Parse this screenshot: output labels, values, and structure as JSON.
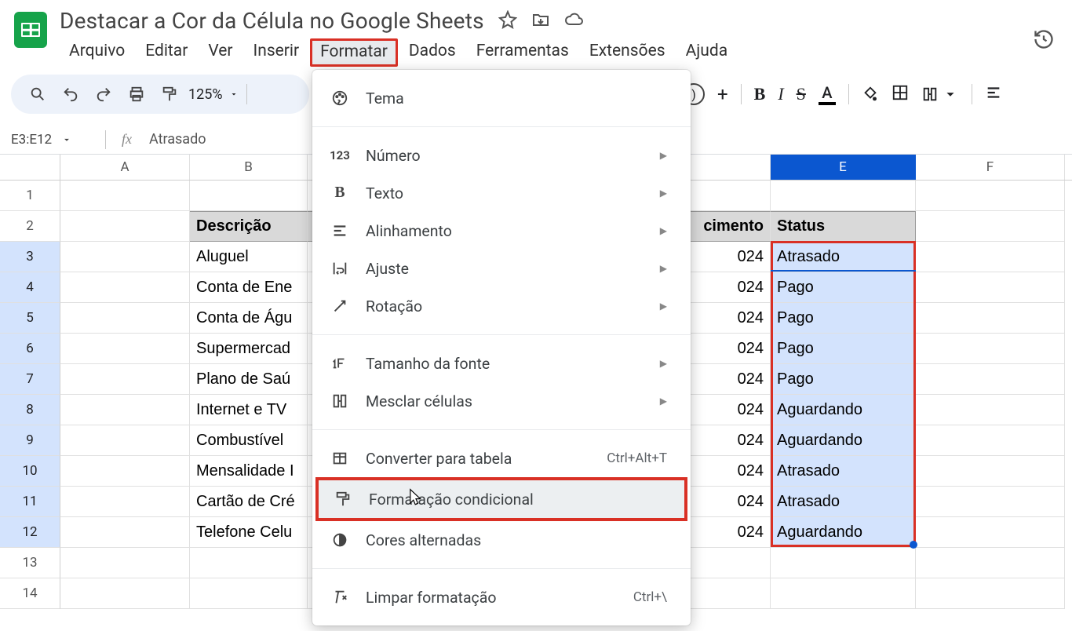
{
  "doc": {
    "title": "Destacar a Cor da Célula no Google Sheets"
  },
  "menubar": [
    "Arquivo",
    "Editar",
    "Ver",
    "Inserir",
    "Formatar",
    "Dados",
    "Ferramentas",
    "Extensões",
    "Ajuda"
  ],
  "activeMenuIndex": 4,
  "toolbar": {
    "zoom": "125%"
  },
  "namebox": "E3:E12",
  "formula": "Atrasado",
  "columns": {
    "A": "A",
    "B": "B",
    "D": "cimento",
    "E": "E",
    "F": "F"
  },
  "headers": {
    "B": "Descrição",
    "D": "cimento",
    "E": "Status"
  },
  "rows": [
    {
      "n": 1
    },
    {
      "n": 2,
      "B": "Descrição",
      "D": "cimento",
      "E": "Status",
      "isHeader": true
    },
    {
      "n": 3,
      "B": "Aluguel",
      "D": "024",
      "E": "Atrasado"
    },
    {
      "n": 4,
      "B": "Conta de Ene",
      "D": "024",
      "E": "Pago"
    },
    {
      "n": 5,
      "B": "Conta de Águ",
      "D": "024",
      "E": "Pago"
    },
    {
      "n": 6,
      "B": "Supermercad",
      "D": "024",
      "E": "Pago"
    },
    {
      "n": 7,
      "B": "Plano de Saú",
      "D": "024",
      "E": "Pago"
    },
    {
      "n": 8,
      "B": "Internet e TV",
      "D": "024",
      "E": "Aguardando"
    },
    {
      "n": 9,
      "B": "Combustível",
      "D": "024",
      "E": "Aguardando"
    },
    {
      "n": 10,
      "B": "Mensalidade I",
      "D": "024",
      "E": "Atrasado"
    },
    {
      "n": 11,
      "B": "Cartão de Cré",
      "D": "024",
      "E": "Atrasado"
    },
    {
      "n": 12,
      "B": "Telefone Celu",
      "D": "024",
      "E": "Aguardando"
    },
    {
      "n": 13
    },
    {
      "n": 14
    }
  ],
  "formatMenu": {
    "theme": "Tema",
    "number": "Número",
    "text": "Texto",
    "align": "Alinhamento",
    "wrap": "Ajuste",
    "rotate": "Rotação",
    "fontsize": "Tamanho da fonte",
    "merge": "Mesclar células",
    "toTable": "Converter para tabela",
    "toTable_kbd": "Ctrl+Alt+T",
    "conditional": "Formatação condicional",
    "altColors": "Cores alternadas",
    "clear": "Limpar formatação",
    "clear_kbd": "Ctrl+\\"
  }
}
